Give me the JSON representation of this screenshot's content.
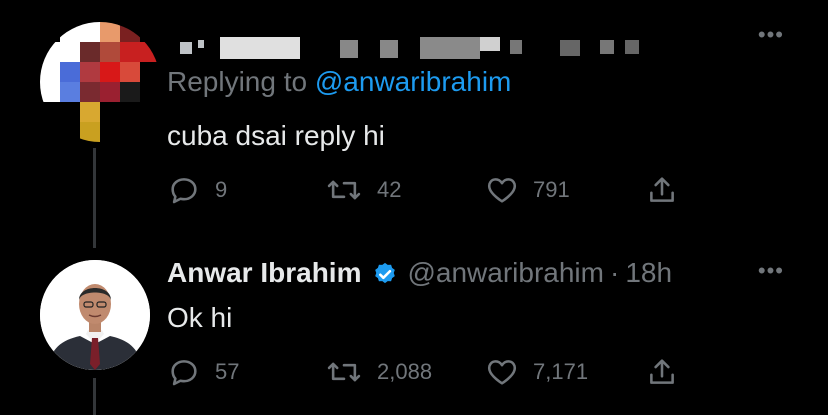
{
  "colors": {
    "background": "#000000",
    "text": "#e7e9ea",
    "muted": "#71767b",
    "link": "#1d9bf0",
    "verified": "#1d9bf0"
  },
  "reply_tweet": {
    "avatar": "pixelated-avatar",
    "replying_prefix": "Replying to",
    "replying_handle": "@anwaribrahim",
    "text": "cuba dsai reply hi",
    "actions": {
      "replies": "9",
      "retweets": "42",
      "likes": "791"
    }
  },
  "main_tweet": {
    "display_name": "Anwar Ibrahim",
    "handle": "@anwaribrahim",
    "separator": "·",
    "time": "18h",
    "text": "Ok hi",
    "actions": {
      "replies": "57",
      "retweets": "2,088",
      "likes": "7,171"
    }
  },
  "icons": [
    "more-icon",
    "reply-icon",
    "retweet-icon",
    "like-icon",
    "share-icon",
    "verified-badge-icon"
  ]
}
